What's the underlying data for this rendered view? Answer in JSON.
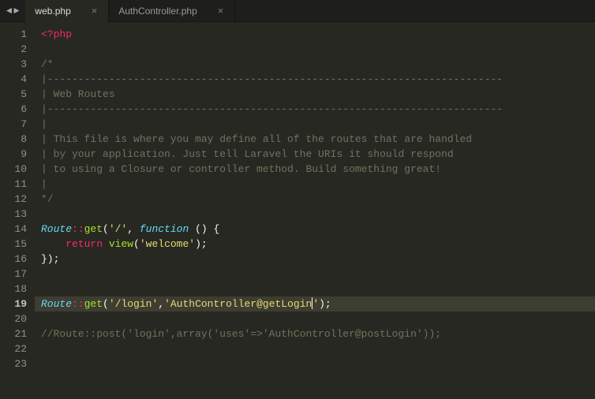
{
  "tabs": [
    {
      "label": "web.php",
      "active": true
    },
    {
      "label": "AuthController.php",
      "active": false
    }
  ],
  "nav": {
    "prev": "◄",
    "next": "►"
  },
  "active_line": 19,
  "lines": [
    {
      "n": 1,
      "t": "<?php",
      "tokens": [
        [
          "kw",
          "<?"
        ],
        [
          "kw",
          "php"
        ]
      ]
    },
    {
      "n": 2,
      "t": ""
    },
    {
      "n": 3,
      "t": "/*",
      "tokens": [
        [
          "cmt",
          "/*"
        ]
      ]
    },
    {
      "n": 4,
      "t": "|--------------------------------------------------------------------------",
      "tokens": [
        [
          "cmt",
          "|--------------------------------------------------------------------------"
        ]
      ]
    },
    {
      "n": 5,
      "t": "| Web Routes",
      "tokens": [
        [
          "cmt",
          "| Web Routes"
        ]
      ]
    },
    {
      "n": 6,
      "t": "|--------------------------------------------------------------------------",
      "tokens": [
        [
          "cmt",
          "|--------------------------------------------------------------------------"
        ]
      ]
    },
    {
      "n": 7,
      "t": "|",
      "tokens": [
        [
          "cmt",
          "|"
        ]
      ]
    },
    {
      "n": 8,
      "t": "| This file is where you may define all of the routes that are handled",
      "tokens": [
        [
          "cmt",
          "| This file is where you may define all of the routes that are handled"
        ]
      ]
    },
    {
      "n": 9,
      "t": "| by your application. Just tell Laravel the URIs it should respond",
      "tokens": [
        [
          "cmt",
          "| by your application. Just tell Laravel the URIs it should respond"
        ]
      ]
    },
    {
      "n": 10,
      "t": "| to using a Closure or controller method. Build something great!",
      "tokens": [
        [
          "cmt",
          "| to using a Closure or controller method. Build something great!"
        ]
      ]
    },
    {
      "n": 11,
      "t": "|",
      "tokens": [
        [
          "cmt",
          "|"
        ]
      ]
    },
    {
      "n": 12,
      "t": "*/",
      "tokens": [
        [
          "cmt",
          "*/"
        ]
      ]
    },
    {
      "n": 13,
      "t": ""
    },
    {
      "n": 14,
      "t": "Route::get('/', function () {",
      "tokens": [
        [
          "cls",
          "Route"
        ],
        [
          "op",
          "::"
        ],
        [
          "name",
          "get"
        ],
        [
          "punct",
          "("
        ],
        [
          "str",
          "'/'"
        ],
        [
          "punct",
          ", "
        ],
        [
          "fn",
          "function"
        ],
        [
          "punct",
          " () {"
        ]
      ]
    },
    {
      "n": 15,
      "t": "    return view('welcome');",
      "tokens": [
        [
          "punct",
          "    "
        ],
        [
          "kw",
          "return"
        ],
        [
          "punct",
          " "
        ],
        [
          "name",
          "view"
        ],
        [
          "punct",
          "("
        ],
        [
          "str",
          "'welcome'"
        ],
        [
          "punct",
          ");"
        ]
      ]
    },
    {
      "n": 16,
      "t": "});",
      "tokens": [
        [
          "punct",
          "});"
        ]
      ]
    },
    {
      "n": 17,
      "t": ""
    },
    {
      "n": 18,
      "t": ""
    },
    {
      "n": 19,
      "t": "Route::get('/login','AuthController@getLogin');",
      "tokens": [
        [
          "cls",
          "Route"
        ],
        [
          "op",
          "::"
        ],
        [
          "name",
          "get"
        ],
        [
          "punct",
          "("
        ],
        [
          "str",
          "'/login'"
        ],
        [
          "punct",
          ","
        ],
        [
          "str",
          "'AuthController@getLogin"
        ],
        [
          "cursor",
          ""
        ],
        [
          "str",
          "'"
        ],
        [
          "punct",
          ");"
        ]
      ]
    },
    {
      "n": 20,
      "t": ""
    },
    {
      "n": 21,
      "t": "//Route::post('login',array('uses'=>'AuthController@postLogin'));",
      "tokens": [
        [
          "cmt",
          "//Route::post('login',array('uses'=>'AuthController@postLogin'));"
        ]
      ]
    },
    {
      "n": 22,
      "t": ""
    },
    {
      "n": 23,
      "t": ""
    }
  ]
}
